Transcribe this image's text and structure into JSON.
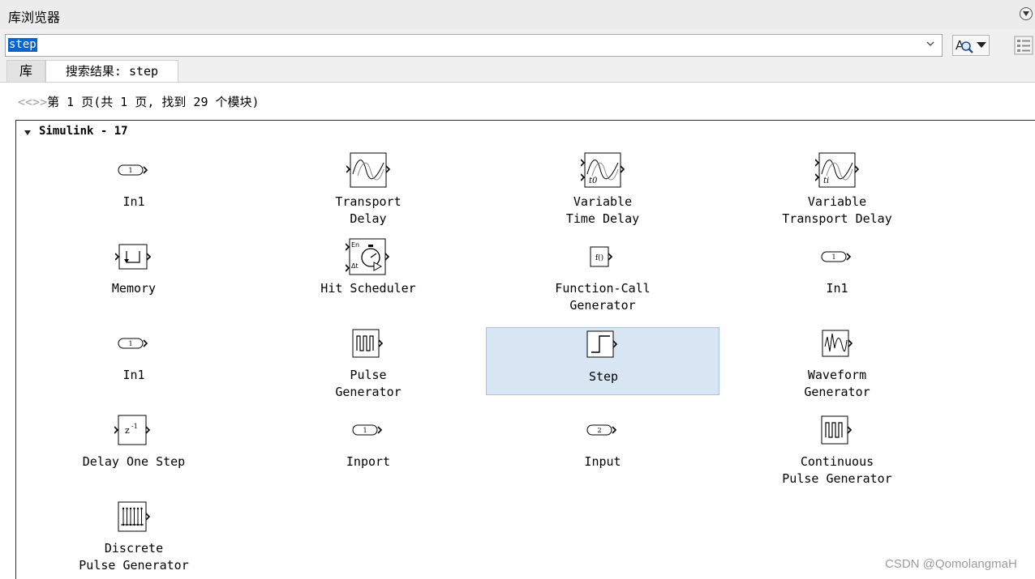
{
  "window": {
    "title": "库浏览器"
  },
  "search": {
    "value": "step"
  },
  "tabs": [
    {
      "label": "库"
    },
    {
      "label": "搜索结果: step"
    }
  ],
  "pager": {
    "prev": "<",
    "sep": "<>",
    "next": ">",
    "text": "第 1 页(共 1 页, 找到 29 个模块)"
  },
  "group": {
    "title": "Simulink - 17"
  },
  "blocks": [
    {
      "label": "In1",
      "icon": "inport-1-icon",
      "port_number": "1"
    },
    {
      "label": "Transport\nDelay",
      "icon": "transport-delay-icon"
    },
    {
      "label": "Variable\nTime Delay",
      "icon": "variable-time-delay-icon",
      "icon_text": "t0"
    },
    {
      "label": "Variable\nTransport Delay",
      "icon": "variable-transport-delay-icon",
      "icon_text": "ti"
    },
    {
      "label": "Memory",
      "icon": "memory-icon"
    },
    {
      "label": "Hit Scheduler",
      "icon": "hit-scheduler-icon",
      "icon_text_top": "En",
      "icon_text_bottom": "Δt"
    },
    {
      "label": "Function-Call\nGenerator",
      "icon": "function-call-generator-icon",
      "icon_text": "f()"
    },
    {
      "label": "In1",
      "icon": "inport-1-icon",
      "port_number": "1"
    },
    {
      "label": "In1",
      "icon": "inport-1-icon",
      "port_number": "1"
    },
    {
      "label": "Pulse\nGenerator",
      "icon": "pulse-generator-icon"
    },
    {
      "label": "Step",
      "icon": "step-icon",
      "selected": true
    },
    {
      "label": "Waveform\nGenerator",
      "icon": "waveform-generator-icon"
    },
    {
      "label": "Delay One Step",
      "icon": "delay-one-step-icon",
      "icon_text": "z-1"
    },
    {
      "label": "Inport",
      "icon": "inport-1-icon",
      "port_number": "1"
    },
    {
      "label": "Input",
      "icon": "inport-2-icon",
      "port_number": "2"
    },
    {
      "label": "Continuous\nPulse Generator",
      "icon": "continuous-pulse-generator-icon"
    },
    {
      "label": "Discrete\nPulse Generator",
      "icon": "discrete-pulse-generator-icon"
    }
  ],
  "watermark": "CSDN @QomolangmaH",
  "colors": {
    "selection": "#0a64d0",
    "selected_cell": "#d8e6f4"
  }
}
